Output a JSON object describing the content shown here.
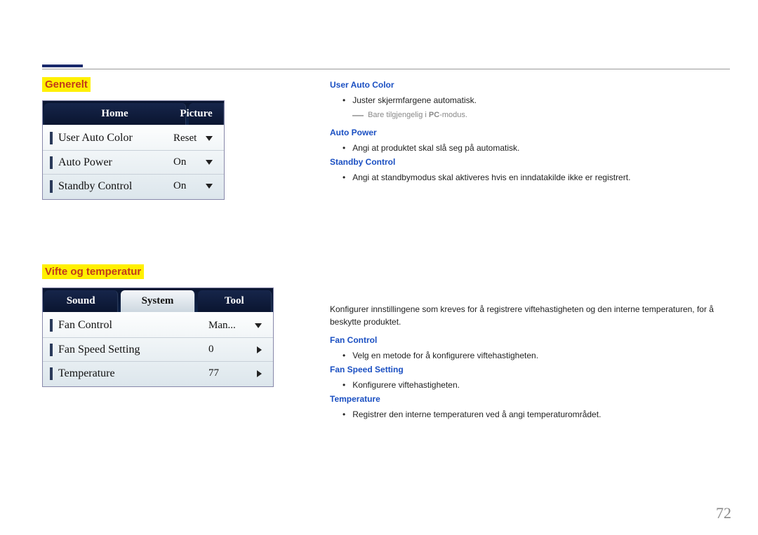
{
  "page_number": "72",
  "section1": {
    "heading": "Generelt",
    "panel": {
      "tabs": [
        "Home",
        "Picture"
      ],
      "rows": [
        {
          "label": "User Auto Color",
          "value": "Reset",
          "control": "dropdown"
        },
        {
          "label": "Auto Power",
          "value": "On",
          "control": "dropdown"
        },
        {
          "label": "Standby Control",
          "value": "On",
          "control": "dropdown"
        }
      ]
    },
    "descriptions": {
      "user_auto_color": {
        "title": "User Auto Color",
        "bullet": "Juster skjermfargene automatisk.",
        "note_prefix": "Bare tilgjengelig i ",
        "note_bold": "PC",
        "note_suffix": "-modus."
      },
      "auto_power": {
        "title": "Auto Power",
        "bullet": "Angi at produktet skal slå seg på automatisk."
      },
      "standby_control": {
        "title": "Standby Control",
        "bullet": "Angi at standbymodus skal aktiveres hvis en inndatakilde ikke er registrert."
      }
    }
  },
  "section2": {
    "heading": "Vifte og temperatur",
    "panel": {
      "tabs": [
        "Sound",
        "System",
        "Tool"
      ],
      "active_tab_index": 1,
      "rows": [
        {
          "label": "Fan Control",
          "value": "Man...",
          "control": "dropdown"
        },
        {
          "label": "Fan Speed Setting",
          "value": "0",
          "control": "spinner"
        },
        {
          "label": "Temperature",
          "value": "77",
          "control": "spinner"
        }
      ]
    },
    "intro": "Konfigurer innstillingene som kreves for å registrere viftehastigheten og den interne temperaturen, for å beskytte produktet.",
    "descriptions": {
      "fan_control": {
        "title": "Fan Control",
        "bullet": "Velg en metode for å konfigurere viftehastigheten."
      },
      "fan_speed_setting": {
        "title": "Fan Speed Setting",
        "bullet": "Konfigurere viftehastigheten."
      },
      "temperature": {
        "title": "Temperature",
        "bullet": "Registrer den interne temperaturen ved å angi temperaturområdet."
      }
    }
  }
}
